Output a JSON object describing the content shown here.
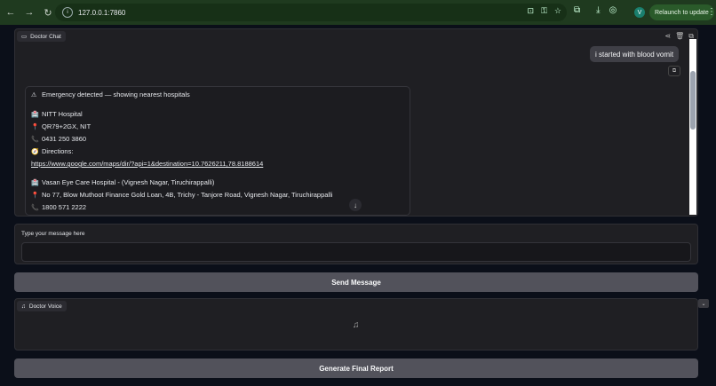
{
  "browser": {
    "url": "127.0.0.1:7860",
    "relaunch_label": "Relaunch to update",
    "avatar_letter": "V"
  },
  "chat": {
    "label": "Doctor Chat",
    "user_message": "i started with blood vomit",
    "bot_lines": [
      {
        "icon": "warning-icon",
        "glyph": "⚠",
        "text": "Emergency detected — showing nearest hospitals"
      },
      {
        "icon": "hospital-icon",
        "glyph": "🏥",
        "text": "NITT Hospital"
      },
      {
        "icon": "pin-icon",
        "glyph": "📍",
        "text": "QR79+2GX, NIT"
      },
      {
        "icon": "phone-icon",
        "glyph": "📞",
        "text": "0431 250 3860"
      },
      {
        "icon": "compass-icon",
        "glyph": "🧭",
        "text": "Directions:"
      },
      {
        "icon": "",
        "glyph": "",
        "text": "https://www.google.com/maps/dir/?api=1&destination=10.7626211,78.8188614"
      },
      {
        "icon": "hospital-icon",
        "glyph": "🏥",
        "text": "Vasan Eye Care Hospital - (Vignesh Nagar, Tiruchirappalli)"
      },
      {
        "icon": "pin-icon",
        "glyph": "📍",
        "text": "No 77, Blow Muthoot Finance Gold Loan, 4B, Trichy - Tanjore Road, Vignesh Nagar, Tiruchirappalli"
      },
      {
        "icon": "phone-icon",
        "glyph": "📞",
        "text": "1800 571 2222"
      }
    ]
  },
  "input": {
    "label": "Type your message here",
    "value": "",
    "placeholder": ""
  },
  "send_label": "Send Message",
  "voice": {
    "label": "Doctor Voice"
  },
  "report_label": "Generate Final Report"
}
